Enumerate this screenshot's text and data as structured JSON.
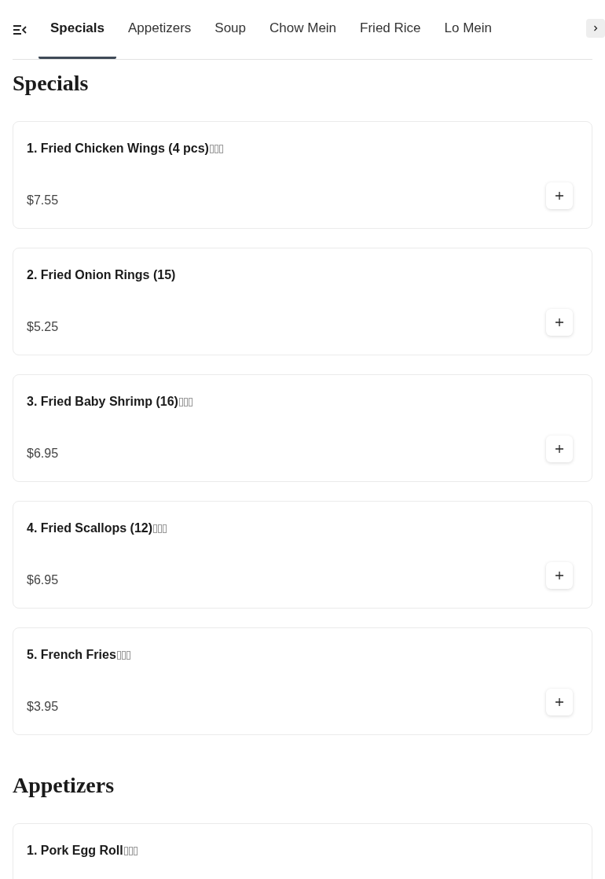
{
  "tabs": [
    {
      "label": "Specials",
      "selected": true
    },
    {
      "label": "Appetizers",
      "selected": false
    },
    {
      "label": "Soup",
      "selected": false
    },
    {
      "label": "Chow Mein",
      "selected": false
    },
    {
      "label": "Fried Rice",
      "selected": false
    },
    {
      "label": "Lo Mein",
      "selected": false
    }
  ],
  "sections": [
    {
      "title": "Specials",
      "items": [
        {
          "name": "1. Fried Chicken Wings (4 pcs)",
          "missing_glyphs": true,
          "price": "$7.55"
        },
        {
          "name": "2. Fried Onion Rings (15)",
          "missing_glyphs": false,
          "price": "$5.25"
        },
        {
          "name": "3. Fried Baby Shrimp (16)",
          "missing_glyphs": true,
          "price": "$6.95"
        },
        {
          "name": "4. Fried Scallops (12)",
          "missing_glyphs": true,
          "price": "$6.95"
        },
        {
          "name": "5. French Fries",
          "missing_glyphs": true,
          "price": "$3.95"
        }
      ]
    },
    {
      "title": "Appetizers",
      "items": [
        {
          "name": "1. Pork Egg Roll",
          "missing_glyphs": true
        }
      ]
    }
  ]
}
